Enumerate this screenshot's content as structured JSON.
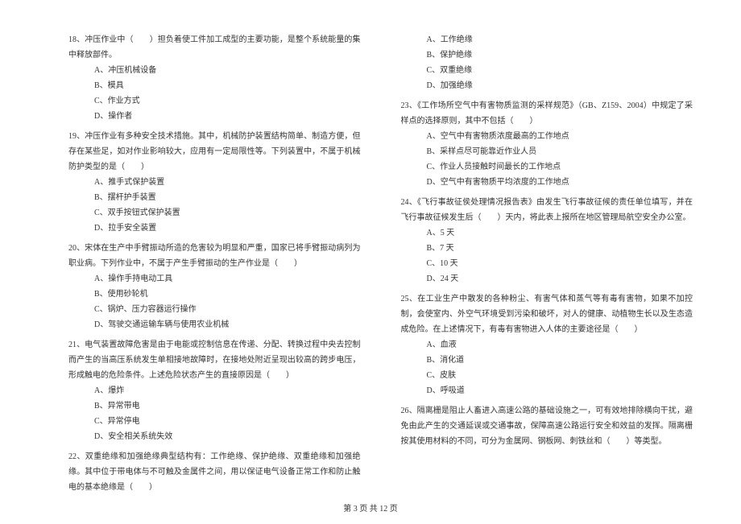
{
  "left_column": {
    "q18": {
      "text": "18、冲压作业中（　　）担负着使工件加工成型的主要功能，是整个系统能量的集中释放部件。",
      "options": [
        "A、冲压机械设备",
        "B、模具",
        "C、作业方式",
        "D、操作者"
      ]
    },
    "q19": {
      "text": "19、冲压作业有多种安全技术措施。其中，机械防护装置结构简单、制造方便，但存在某些足，如对作业影响较大，应用有一定局限性等。下列装置中，不属于机械防护类型的是（　　）",
      "options": [
        "A、推手式保护装置",
        "B、摆杆护手装置",
        "C、双手按钮式保护装置",
        "D、拉手安全装置"
      ]
    },
    "q20": {
      "text": "20、宋体在生产中手臂振动所造的危害较为明显和严重，国家已将手臂振动病列为职业病。下列作业中，不属于产生手臂振动的生产作业是（　　）",
      "options": [
        "A、操作手持电动工具",
        "B、使用砂轮机",
        "C、锅炉、压力容器运行操作",
        "D、驾驶交通运输车辆与使用农业机械"
      ]
    },
    "q21": {
      "text": "21、电气装置故障危害是由于电能或控制信息在传递、分配、转换过程中央去控制而产生的当高压系统发生单相接地故障时，在接地处附近呈现出较高的跨步电压，形成触电的危险条件。上述危险状态产生的直接原因是（　　）",
      "options": [
        "A、爆炸",
        "B、异常带电",
        "C、异常停电",
        "D、安全相关系统失效"
      ]
    },
    "q22": {
      "text": "22、双重绝缘和加强绝缘典型结构有：工作绝缘、保护绝缘、双重绝缘和加强绝缘。其中位于带电体与不可触及金属件之间，用以保证电气设备正常工作和防止触电的基本绝缘是（　　）"
    }
  },
  "right_column": {
    "q22_options": [
      "A、工作绝缘",
      "B、保护绝缘",
      "C、双重绝缘",
      "D、加强绝缘"
    ],
    "q23": {
      "text": "23、《工作场所空气中有害物质监测的采样规范》（GB、Z159、2004）中规定了采样点的选择原则，其中不包括（　　）",
      "options": [
        "A、空气中有害物质浓度最高的工作地点",
        "B、采样点尽可能靠近作业人员",
        "C、作业人员接触时间最长的工作地点",
        "D、空气中有害物质平均浓度的工作地点"
      ]
    },
    "q24": {
      "text": "24、《飞行事故征侯处理情况报告表》由发生飞行事故征候的责任单位填写，并在飞行事故征候发生后（　　）天内，将此表上报所在地区管理局航空安全办公室。",
      "options": [
        "A、5 天",
        "B、7 天",
        "C、10 天",
        "D、24 天"
      ]
    },
    "q25": {
      "text": "25、在工业生产中散发的各种粉尘、有害气体和蒸气等有毒有害物，如果不加控制，会使室内、外空气环境受到污染和破坏，对人的健康、动植物生长以及生态造成危险。在上述情况下，有毒有害物进入人体的主要途径是（　　）",
      "options": [
        "A、血液",
        "B、消化道",
        "C、皮肤",
        "D、呼吸道"
      ]
    },
    "q26": {
      "text": "26、隔离栅是阻止人畜进入高速公路的基础设施之一，可有效地排除横向干扰，避免由此产生的交通延误或交通事故，保障高速公路运行安全和效益的发挥。隔离栅按其使用材料的不同，可分为金属网、钢板网、刺铁丝和（　　）等类型。"
    }
  },
  "footer": "第 3 页 共 12 页"
}
